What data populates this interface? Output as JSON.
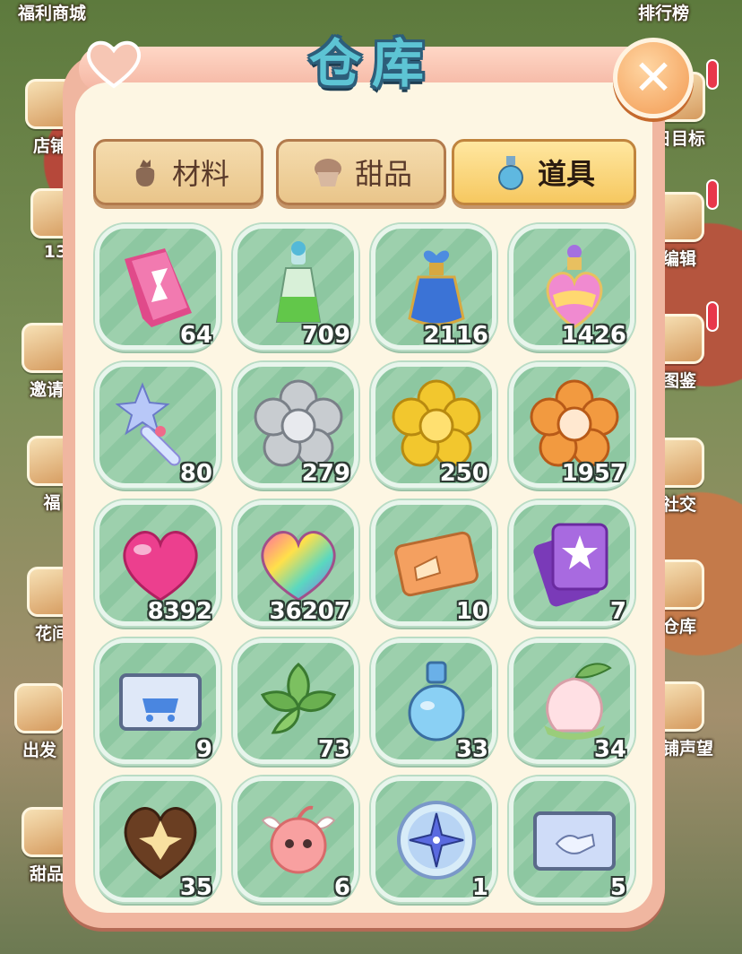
{
  "window": {
    "title": "仓库",
    "close_label": "✕"
  },
  "side_left": [
    {
      "label": "福利商城"
    },
    {
      "label": "店铺"
    },
    {
      "label": "13"
    },
    {
      "label": "邀请"
    },
    {
      "label": "福"
    },
    {
      "label": "花间"
    },
    {
      "label": "出发"
    },
    {
      "label": "甜品"
    }
  ],
  "side_right": [
    {
      "label": "排行榜"
    },
    {
      "label": "日目标"
    },
    {
      "label": "编辑"
    },
    {
      "label": "图鉴"
    },
    {
      "label": "社交"
    },
    {
      "label": "仓库"
    },
    {
      "label": "店铺声望"
    }
  ],
  "tabs": [
    {
      "label": "材料",
      "icon": "bag-icon",
      "active": false
    },
    {
      "label": "甜品",
      "icon": "muffin-icon",
      "active": false
    },
    {
      "label": "道具",
      "icon": "potion-flask-icon",
      "active": true
    }
  ],
  "items": [
    {
      "name": "hourglass-ticket-icon",
      "count": "64"
    },
    {
      "name": "green-potion-icon",
      "count": "709"
    },
    {
      "name": "blue-heart-potion-icon",
      "count": "2116"
    },
    {
      "name": "rainbow-perfume-icon",
      "count": "1426"
    },
    {
      "name": "star-wand-icon",
      "count": "80"
    },
    {
      "name": "silver-flower-icon",
      "count": "279"
    },
    {
      "name": "gold-flower-icon",
      "count": "250"
    },
    {
      "name": "orange-flower-icon",
      "count": "1957"
    },
    {
      "name": "pink-heart-icon",
      "count": "8392"
    },
    {
      "name": "rainbow-heart-icon",
      "count": "36207"
    },
    {
      "name": "cake-ticket-icon",
      "count": "10"
    },
    {
      "name": "star-card-icon",
      "count": "7"
    },
    {
      "name": "shop-cart-card-icon",
      "count": "9"
    },
    {
      "name": "leaf-icon",
      "count": "73"
    },
    {
      "name": "blue-flask-icon",
      "count": "33"
    },
    {
      "name": "peach-icon",
      "count": "34"
    },
    {
      "name": "chocolate-heart-icon",
      "count": "35"
    },
    {
      "name": "winged-spirit-icon",
      "count": "6"
    },
    {
      "name": "compass-star-icon",
      "count": "1"
    },
    {
      "name": "handshake-card-icon",
      "count": "5"
    }
  ]
}
